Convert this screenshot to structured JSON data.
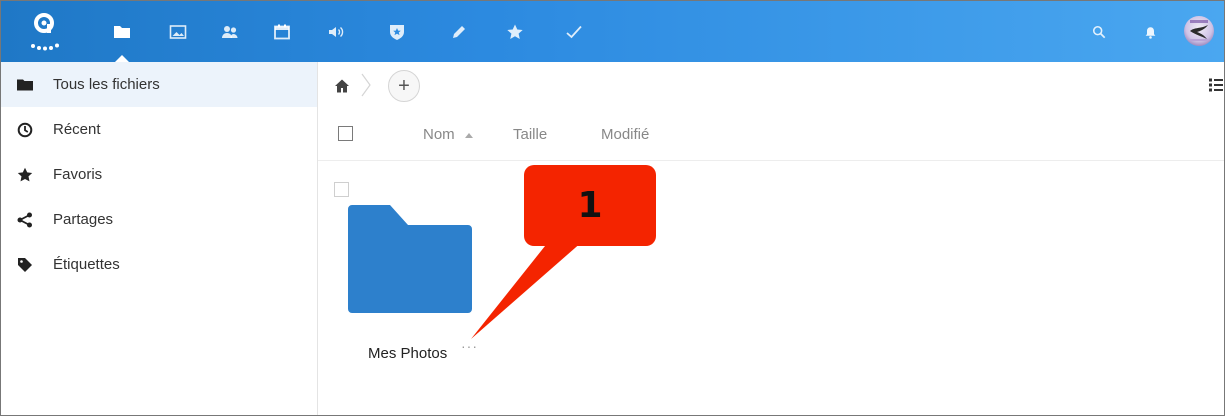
{
  "topbar": {
    "apps": [
      {
        "icon": "folder-icon",
        "name": "files"
      },
      {
        "icon": "image-icon",
        "name": "gallery"
      },
      {
        "icon": "contacts-icon",
        "name": "contacts"
      },
      {
        "icon": "calendar-icon",
        "name": "calendar"
      },
      {
        "icon": "speaker-icon",
        "name": "announcements"
      },
      {
        "icon": "shield-icon",
        "name": "security"
      },
      {
        "icon": "pencil-icon",
        "name": "notes"
      },
      {
        "icon": "star-icon",
        "name": "favorites"
      },
      {
        "icon": "checkmark-icon",
        "name": "tasks"
      }
    ],
    "right_icons": [
      "search-icon",
      "bell-icon"
    ],
    "accent": "#2c8ae0"
  },
  "sidebar": {
    "items": [
      {
        "label": "Tous les fichiers",
        "icon": "folder-icon",
        "active": true
      },
      {
        "label": "Récent",
        "icon": "clock-icon"
      },
      {
        "label": "Favoris",
        "icon": "star-icon"
      },
      {
        "label": "Partages",
        "icon": "share-icon"
      },
      {
        "label": "Étiquettes",
        "icon": "tag-icon"
      }
    ]
  },
  "main": {
    "add_label": "+",
    "columns": {
      "name": "Nom",
      "size": "Taille",
      "modified": "Modifié"
    },
    "files": [
      {
        "name": "Mes Photos",
        "type": "folder",
        "more": "···"
      }
    ]
  },
  "annotation": {
    "label": "1",
    "color": "#f42400"
  }
}
